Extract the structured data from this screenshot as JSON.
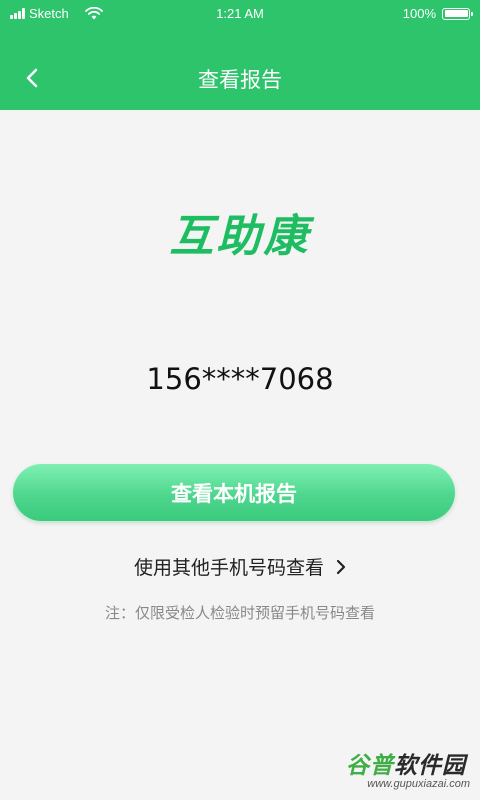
{
  "status_bar": {
    "carrier": "Sketch",
    "time": "1:21 AM",
    "battery": "100%"
  },
  "header": {
    "title": "查看报告"
  },
  "main": {
    "logo_text": "互助康",
    "phone_number": "156****7068",
    "primary_button_label": "查看本机报告",
    "other_phone_link_label": "使用其他手机号码查看",
    "note": "注：仅限受检人检验时预留手机号码查看"
  },
  "watermark": {
    "title_part1": "谷普",
    "title_part2": "软件园",
    "url": "www.gupuxiazai.com"
  },
  "colors": {
    "brand_green": "#2dc46c",
    "button_gradient_top": "#7ff0b2",
    "button_gradient_bottom": "#3acb7c",
    "background": "#f4f4f4"
  }
}
